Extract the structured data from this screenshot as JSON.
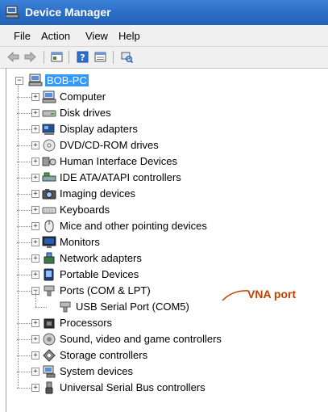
{
  "window": {
    "title": "Device Manager"
  },
  "menu": {
    "file": "File",
    "action": "Action",
    "view": "View",
    "help": "Help"
  },
  "tree": {
    "root": "BOB-PC",
    "items": [
      {
        "label": "Computer",
        "icon": "computer-icon"
      },
      {
        "label": "Disk drives",
        "icon": "disk-drive-icon"
      },
      {
        "label": "Display adapters",
        "icon": "display-adapter-icon"
      },
      {
        "label": "DVD/CD-ROM drives",
        "icon": "dvd-drive-icon"
      },
      {
        "label": "Human Interface Devices",
        "icon": "hid-icon"
      },
      {
        "label": "IDE ATA/ATAPI controllers",
        "icon": "ide-controller-icon"
      },
      {
        "label": "Imaging devices",
        "icon": "camera-icon"
      },
      {
        "label": "Keyboards",
        "icon": "keyboard-icon"
      },
      {
        "label": "Mice and other pointing devices",
        "icon": "mouse-icon"
      },
      {
        "label": "Monitors",
        "icon": "monitor-icon"
      },
      {
        "label": "Network adapters",
        "icon": "network-adapter-icon"
      },
      {
        "label": "Portable Devices",
        "icon": "portable-device-icon"
      },
      {
        "label": "Ports (COM & LPT)",
        "icon": "port-icon",
        "expanded": true
      },
      {
        "label": "USB Serial Port (COM5)",
        "icon": "port-icon",
        "child": true
      },
      {
        "label": "Processors",
        "icon": "processor-icon"
      },
      {
        "label": "Sound, video and game controllers",
        "icon": "speaker-icon"
      },
      {
        "label": "Storage controllers",
        "icon": "storage-controller-icon"
      },
      {
        "label": "System devices",
        "icon": "system-device-icon"
      },
      {
        "label": "Universal Serial Bus controllers",
        "icon": "usb-icon"
      }
    ]
  },
  "annotation": {
    "text": "VNA port"
  },
  "colors": {
    "title_bar": "#2a6cc4",
    "selection": "#3399ff",
    "annotation": "#c04000"
  }
}
